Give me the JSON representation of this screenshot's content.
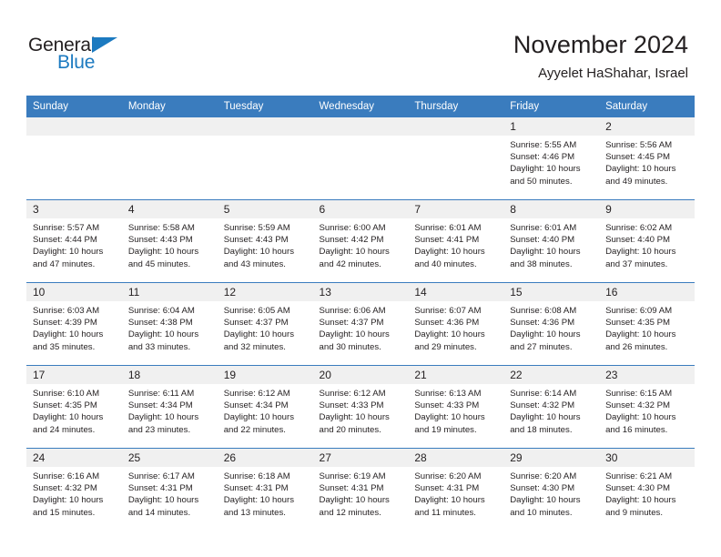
{
  "logo": {
    "word1": "General",
    "word2": "Blue",
    "triangle_icon": "triangle-icon",
    "color_dark": "#231f20",
    "color_blue": "#1c7ac0"
  },
  "header": {
    "title": "November 2024",
    "subtitle": "Ayyelet HaShahar, Israel"
  },
  "theme": {
    "header_bg": "#3a7cbe",
    "daynum_bg": "#f0f0f0",
    "row_border": "#3a7cbe",
    "text": "#231f20"
  },
  "weekdays": [
    "Sunday",
    "Monday",
    "Tuesday",
    "Wednesday",
    "Thursday",
    "Friday",
    "Saturday"
  ],
  "labels": {
    "sunrise": "Sunrise:",
    "sunset": "Sunset:",
    "daylight": "Daylight:"
  },
  "weeks": [
    [
      {
        "day": "",
        "blank": true
      },
      {
        "day": "",
        "blank": true
      },
      {
        "day": "",
        "blank": true
      },
      {
        "day": "",
        "blank": true
      },
      {
        "day": "",
        "blank": true
      },
      {
        "day": "1",
        "sunrise": "Sunrise: 5:55 AM",
        "sunset": "Sunset: 4:46 PM",
        "daylight": "Daylight: 10 hours and 50 minutes."
      },
      {
        "day": "2",
        "sunrise": "Sunrise: 5:56 AM",
        "sunset": "Sunset: 4:45 PM",
        "daylight": "Daylight: 10 hours and 49 minutes."
      }
    ],
    [
      {
        "day": "3",
        "sunrise": "Sunrise: 5:57 AM",
        "sunset": "Sunset: 4:44 PM",
        "daylight": "Daylight: 10 hours and 47 minutes."
      },
      {
        "day": "4",
        "sunrise": "Sunrise: 5:58 AM",
        "sunset": "Sunset: 4:43 PM",
        "daylight": "Daylight: 10 hours and 45 minutes."
      },
      {
        "day": "5",
        "sunrise": "Sunrise: 5:59 AM",
        "sunset": "Sunset: 4:43 PM",
        "daylight": "Daylight: 10 hours and 43 minutes."
      },
      {
        "day": "6",
        "sunrise": "Sunrise: 6:00 AM",
        "sunset": "Sunset: 4:42 PM",
        "daylight": "Daylight: 10 hours and 42 minutes."
      },
      {
        "day": "7",
        "sunrise": "Sunrise: 6:01 AM",
        "sunset": "Sunset: 4:41 PM",
        "daylight": "Daylight: 10 hours and 40 minutes."
      },
      {
        "day": "8",
        "sunrise": "Sunrise: 6:01 AM",
        "sunset": "Sunset: 4:40 PM",
        "daylight": "Daylight: 10 hours and 38 minutes."
      },
      {
        "day": "9",
        "sunrise": "Sunrise: 6:02 AM",
        "sunset": "Sunset: 4:40 PM",
        "daylight": "Daylight: 10 hours and 37 minutes."
      }
    ],
    [
      {
        "day": "10",
        "sunrise": "Sunrise: 6:03 AM",
        "sunset": "Sunset: 4:39 PM",
        "daylight": "Daylight: 10 hours and 35 minutes."
      },
      {
        "day": "11",
        "sunrise": "Sunrise: 6:04 AM",
        "sunset": "Sunset: 4:38 PM",
        "daylight": "Daylight: 10 hours and 33 minutes."
      },
      {
        "day": "12",
        "sunrise": "Sunrise: 6:05 AM",
        "sunset": "Sunset: 4:37 PM",
        "daylight": "Daylight: 10 hours and 32 minutes."
      },
      {
        "day": "13",
        "sunrise": "Sunrise: 6:06 AM",
        "sunset": "Sunset: 4:37 PM",
        "daylight": "Daylight: 10 hours and 30 minutes."
      },
      {
        "day": "14",
        "sunrise": "Sunrise: 6:07 AM",
        "sunset": "Sunset: 4:36 PM",
        "daylight": "Daylight: 10 hours and 29 minutes."
      },
      {
        "day": "15",
        "sunrise": "Sunrise: 6:08 AM",
        "sunset": "Sunset: 4:36 PM",
        "daylight": "Daylight: 10 hours and 27 minutes."
      },
      {
        "day": "16",
        "sunrise": "Sunrise: 6:09 AM",
        "sunset": "Sunset: 4:35 PM",
        "daylight": "Daylight: 10 hours and 26 minutes."
      }
    ],
    [
      {
        "day": "17",
        "sunrise": "Sunrise: 6:10 AM",
        "sunset": "Sunset: 4:35 PM",
        "daylight": "Daylight: 10 hours and 24 minutes."
      },
      {
        "day": "18",
        "sunrise": "Sunrise: 6:11 AM",
        "sunset": "Sunset: 4:34 PM",
        "daylight": "Daylight: 10 hours and 23 minutes."
      },
      {
        "day": "19",
        "sunrise": "Sunrise: 6:12 AM",
        "sunset": "Sunset: 4:34 PM",
        "daylight": "Daylight: 10 hours and 22 minutes."
      },
      {
        "day": "20",
        "sunrise": "Sunrise: 6:12 AM",
        "sunset": "Sunset: 4:33 PM",
        "daylight": "Daylight: 10 hours and 20 minutes."
      },
      {
        "day": "21",
        "sunrise": "Sunrise: 6:13 AM",
        "sunset": "Sunset: 4:33 PM",
        "daylight": "Daylight: 10 hours and 19 minutes."
      },
      {
        "day": "22",
        "sunrise": "Sunrise: 6:14 AM",
        "sunset": "Sunset: 4:32 PM",
        "daylight": "Daylight: 10 hours and 18 minutes."
      },
      {
        "day": "23",
        "sunrise": "Sunrise: 6:15 AM",
        "sunset": "Sunset: 4:32 PM",
        "daylight": "Daylight: 10 hours and 16 minutes."
      }
    ],
    [
      {
        "day": "24",
        "sunrise": "Sunrise: 6:16 AM",
        "sunset": "Sunset: 4:32 PM",
        "daylight": "Daylight: 10 hours and 15 minutes."
      },
      {
        "day": "25",
        "sunrise": "Sunrise: 6:17 AM",
        "sunset": "Sunset: 4:31 PM",
        "daylight": "Daylight: 10 hours and 14 minutes."
      },
      {
        "day": "26",
        "sunrise": "Sunrise: 6:18 AM",
        "sunset": "Sunset: 4:31 PM",
        "daylight": "Daylight: 10 hours and 13 minutes."
      },
      {
        "day": "27",
        "sunrise": "Sunrise: 6:19 AM",
        "sunset": "Sunset: 4:31 PM",
        "daylight": "Daylight: 10 hours and 12 minutes."
      },
      {
        "day": "28",
        "sunrise": "Sunrise: 6:20 AM",
        "sunset": "Sunset: 4:31 PM",
        "daylight": "Daylight: 10 hours and 11 minutes."
      },
      {
        "day": "29",
        "sunrise": "Sunrise: 6:20 AM",
        "sunset": "Sunset: 4:30 PM",
        "daylight": "Daylight: 10 hours and 10 minutes."
      },
      {
        "day": "30",
        "sunrise": "Sunrise: 6:21 AM",
        "sunset": "Sunset: 4:30 PM",
        "daylight": "Daylight: 10 hours and 9 minutes."
      }
    ]
  ]
}
